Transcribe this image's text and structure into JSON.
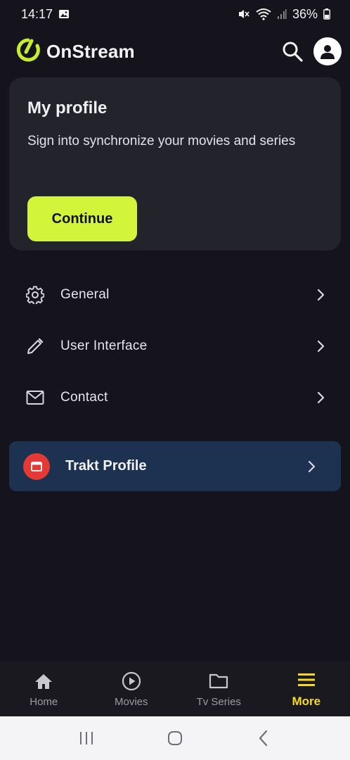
{
  "status_bar": {
    "time": "14:17",
    "battery": "36%"
  },
  "header": {
    "app_name": "OnStream",
    "brand_color": "#c6ee2f"
  },
  "profile_card": {
    "title": "My profile",
    "description": "Sign into synchronize your movies and series",
    "continue_label": "Continue",
    "accent": "#d2f43a"
  },
  "menu": {
    "items": [
      {
        "label": "General",
        "icon": "gear-icon"
      },
      {
        "label": "User Interface",
        "icon": "pencil-icon"
      },
      {
        "label": "Contact",
        "icon": "mail-icon"
      }
    ]
  },
  "trakt": {
    "label": "Trakt Profile",
    "icon": "trakt-icon",
    "bg": "#1d3250"
  },
  "bottom_nav": {
    "tabs": [
      {
        "label": "Home",
        "icon": "home-icon",
        "active": false
      },
      {
        "label": "Movies",
        "icon": "play-circle-icon",
        "active": false
      },
      {
        "label": "Tv Series",
        "icon": "folder-icon",
        "active": false
      },
      {
        "label": "More",
        "icon": "menu-icon",
        "active": true
      }
    ],
    "active_color": "#f6d921"
  }
}
